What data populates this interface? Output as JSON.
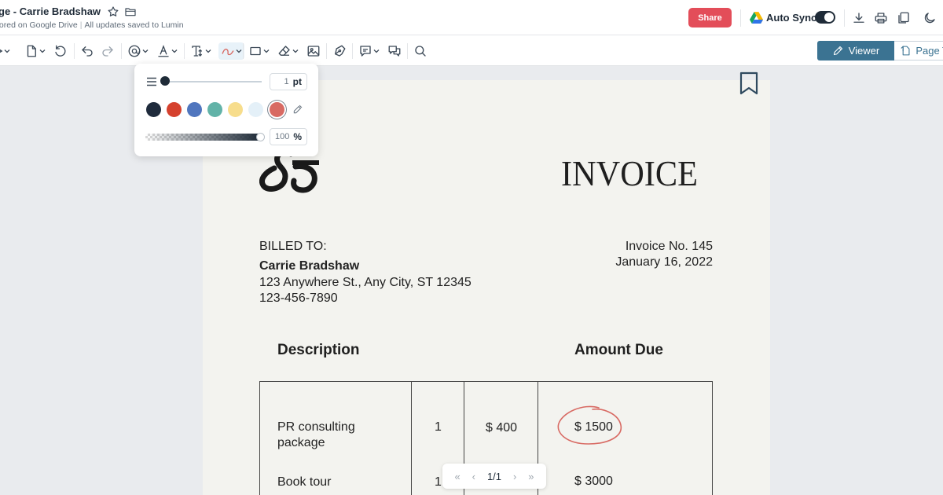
{
  "header": {
    "title": "ge - Carrie Bradshaw",
    "storage_status": "tored on Google Drive",
    "save_status": "All updates saved to Lumin",
    "share_label": "Share",
    "autosync_label": "Auto Sync",
    "autosync_on": true
  },
  "toolbar": {
    "viewer_label": "Viewer",
    "page_tools_label": "Page T"
  },
  "pen_popover": {
    "thickness_value": "1",
    "thickness_unit": "pt",
    "opacity_value": "100",
    "opacity_unit": "%",
    "colors": [
      "#1f2b3c",
      "#d5412e",
      "#5076be",
      "#62b3a8",
      "#f7dd8c",
      "#e4f0f8",
      "#d86a63"
    ],
    "selected_color": "#d86a63"
  },
  "invoice": {
    "title": "INVOICE",
    "billed_to_label": "BILLED TO:",
    "client_name": "Carrie Bradshaw",
    "client_address": "123 Anywhere St., Any City, ST 12345",
    "client_phone": "123-456-7890",
    "invoice_no": "Invoice No. 145",
    "date": "January 16, 2022",
    "col_description": "Description",
    "col_amount_due": "Amount Due",
    "rows": [
      {
        "desc_line1": "PR consulting",
        "desc_line2": "package",
        "qty": "1",
        "price": "$ 400",
        "amount": "$ 1500"
      },
      {
        "desc_line1": "Book tour",
        "desc_line2": "",
        "qty": "1",
        "price": "",
        "amount": "$ 3000"
      }
    ]
  },
  "page_nav": {
    "indicator": "1/1"
  },
  "colors": {
    "accent": "#3b7392",
    "share": "#e34d59",
    "annotation": "#d86a63"
  }
}
